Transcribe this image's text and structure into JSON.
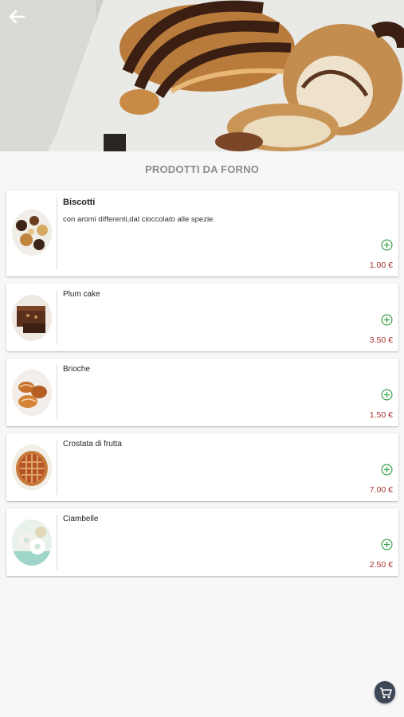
{
  "header": {
    "title": "PRODOTTI DA FORNO"
  },
  "products": [
    {
      "name": "Biscotti",
      "description": "con aromi differenti,dal cioccolato alle spezie.",
      "price": "1.00 €",
      "icon": "cookies-image"
    },
    {
      "name": "Plum cake",
      "description": "",
      "price": "3.50 €",
      "icon": "plum-cake-image"
    },
    {
      "name": "Brioche",
      "description": "",
      "price": "1.50 €",
      "icon": "brioche-image"
    },
    {
      "name": "Crostata di frutta",
      "description": "",
      "price": "7.00 €",
      "icon": "tart-image"
    },
    {
      "name": "Ciambelle",
      "description": "",
      "price": "2.50 €",
      "icon": "donuts-image"
    }
  ],
  "colors": {
    "accent_green": "#3aa24a",
    "price_red": "#a8342f",
    "fab_dark": "#3e4756",
    "title_grey": "#8c8c8c"
  },
  "icons": {
    "back": "arrow-left-icon",
    "add": "add-circle-icon",
    "cart": "cart-icon"
  }
}
